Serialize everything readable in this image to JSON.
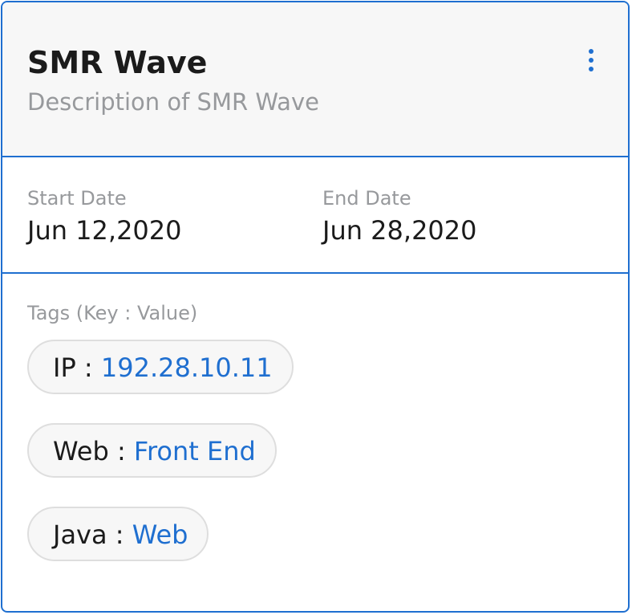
{
  "card": {
    "title": "SMR Wave",
    "description": "Description of SMR Wave",
    "menu_icon": "kebab-vertical-icon"
  },
  "dates": {
    "start_label": "Start Date",
    "start_value": "Jun 12,2020",
    "end_label": "End Date",
    "end_value": "Jun 28,2020"
  },
  "tags": {
    "label": "Tags (Key : Value)",
    "separator": " : ",
    "items": [
      {
        "key": "IP",
        "value": "192.28.10.11"
      },
      {
        "key": "Web",
        "value": "Front End"
      },
      {
        "key": "Java",
        "value": "Web"
      }
    ]
  },
  "colors": {
    "accent": "#1f6fd0",
    "muted_text": "#97999c",
    "primary_text": "#1b1b1b",
    "header_bg": "#f7f7f7",
    "chip_border": "#dedede"
  }
}
